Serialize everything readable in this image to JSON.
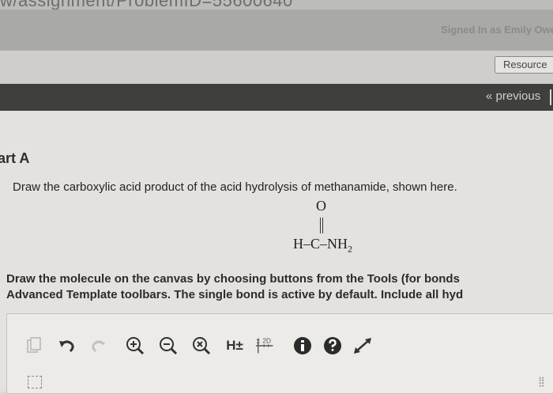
{
  "page": {
    "breadcrumb": "w/assignment/ProblemID=55600640",
    "signed_in": "Signed In as Emily Owe"
  },
  "header": {
    "resources_label": "Resource",
    "previous_label": "« previous"
  },
  "problem": {
    "part_title": "art A",
    "question": "Draw the carboxylic acid product of the acid hydrolysis of methanamide, shown here.",
    "molecule": {
      "oxygen": "O",
      "formula_main": "H–C–NH",
      "formula_sub": "2"
    },
    "instructions_line1": "Draw the molecule on the canvas by choosing buttons from the Tools (for bonds",
    "instructions_line2": "Advanced Template toolbars. The single bond is active by default. Include all hyd"
  },
  "toolbar": {
    "tools": [
      {
        "name": "copy-icon"
      },
      {
        "name": "undo-icon"
      },
      {
        "name": "redo-icon"
      },
      {
        "name": "zoom-in-icon"
      },
      {
        "name": "zoom-out-icon"
      },
      {
        "name": "reset-zoom-icon"
      },
      {
        "name": "hydrogen-toggle",
        "label": "H±"
      },
      {
        "name": "2d-clean-icon",
        "label": "2D"
      },
      {
        "name": "info-icon"
      },
      {
        "name": "help-icon"
      },
      {
        "name": "expand-icon"
      }
    ]
  }
}
